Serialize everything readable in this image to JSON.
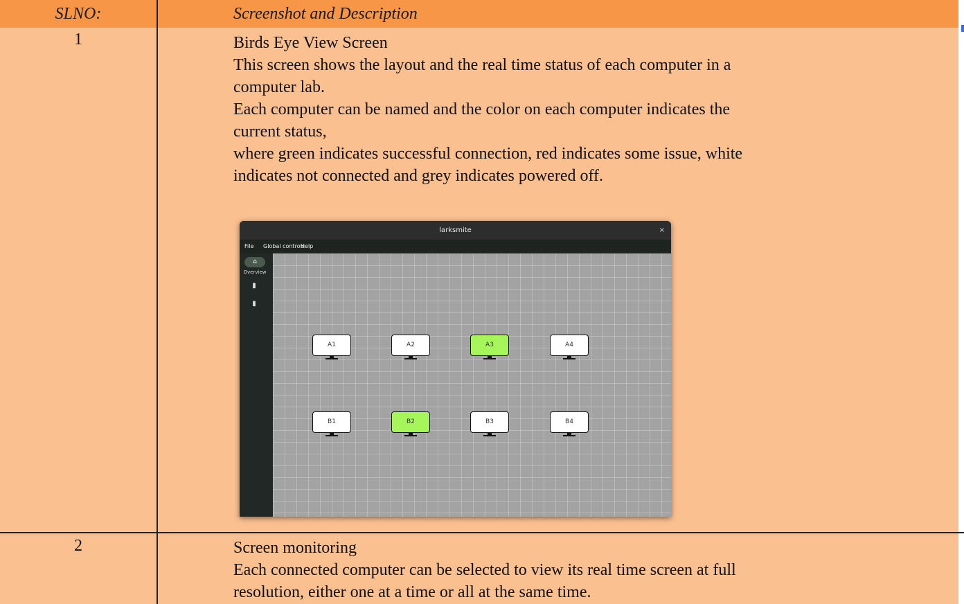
{
  "table": {
    "header": {
      "slno": "SLNO:",
      "desc": "Screenshot and Description"
    },
    "rows": [
      {
        "slno": "1",
        "lines": [
          "Birds Eye View Screen",
          "This screen shows the layout and the real time status of each computer in a",
          "computer lab.",
          "Each computer can be named and the color on each computer indicates the",
          "current status,",
          "where green indicates successful connection, red indicates some issue, white",
          "indicates not connected and grey indicates powered off."
        ]
      },
      {
        "slno": "2",
        "lines": [
          "Screen monitoring",
          "Each connected computer can be selected to view its real time screen at full",
          "resolution, either one at a time or all at the same time."
        ]
      }
    ]
  },
  "app": {
    "title": "larksmite",
    "close": "×",
    "menu": [
      "File",
      "Global controls",
      "Help"
    ],
    "sidebar": {
      "overview_label": "Overview",
      "home_icon": "home-icon",
      "icons": [
        "slideshow-icon",
        "document-icon"
      ]
    },
    "computers": [
      {
        "name": "A1",
        "status": "white"
      },
      {
        "name": "A2",
        "status": "white"
      },
      {
        "name": "A3",
        "status": "green"
      },
      {
        "name": "A4",
        "status": "white"
      },
      {
        "name": "B1",
        "status": "white"
      },
      {
        "name": "B2",
        "status": "green"
      },
      {
        "name": "B3",
        "status": "white"
      },
      {
        "name": "B4",
        "status": "white"
      }
    ]
  },
  "colors": {
    "header": "#f79646",
    "row": "#fac090",
    "green": "#a6f55a",
    "canvas": "#a3a3a3"
  }
}
